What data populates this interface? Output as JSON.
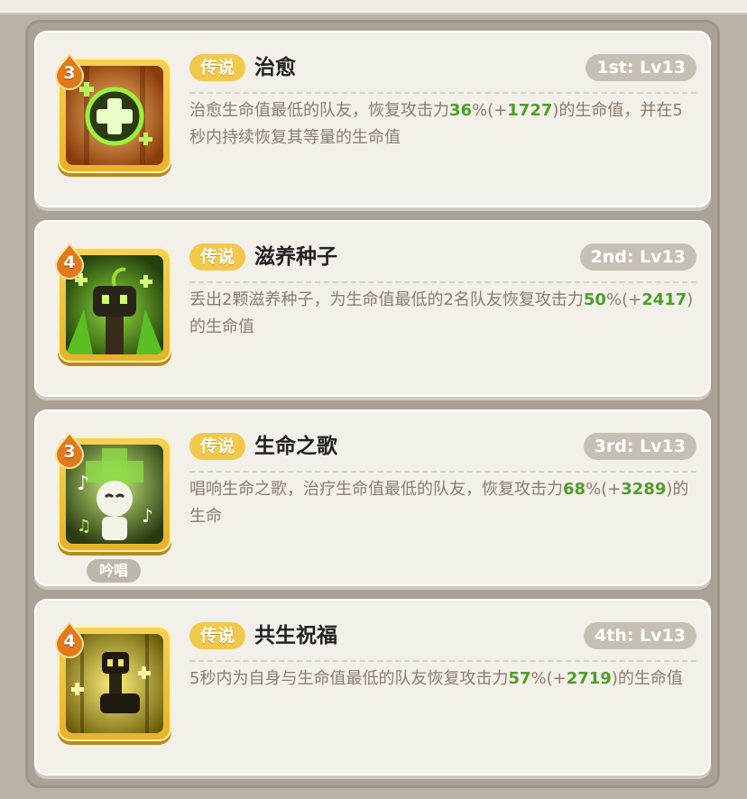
{
  "skills": [
    {
      "level": "3",
      "rarity": "传说",
      "name": "治愈",
      "rank": "1st: Lv13",
      "desc_before": "治愈生命值最低的队友，恢复攻击力",
      "percent": "36",
      "pct_sign": "%",
      "paren_open": "(+",
      "bonus": "1727",
      "paren_close": ")",
      "desc_after": "的生命值，并在5秒内持续恢复其等量的生命值",
      "icon": "heal-cross-icon"
    },
    {
      "level": "4",
      "rarity": "传说",
      "name": "滋养种子",
      "rank": "2nd: Lv13",
      "desc_before": "丢出2颗滋养种子，为生命值最低的2名队友恢复攻击力",
      "percent": "50",
      "pct_sign": "%",
      "paren_open": "(+",
      "bonus": "2417",
      "paren_close": ")",
      "desc_after": "的生命值",
      "icon": "seed-sprout-icon"
    },
    {
      "level": "3",
      "rarity": "传说",
      "name": "生命之歌",
      "rank": "3rd: Lv13",
      "desc_before": "唱响生命之歌，治疗生命值最低的队友，恢复攻击力",
      "percent": "68",
      "pct_sign": "%",
      "paren_open": "(+",
      "bonus": "3289",
      "paren_close": ")",
      "desc_after": "的生命",
      "icon": "song-of-life-icon",
      "tag": "吟唱"
    },
    {
      "level": "4",
      "rarity": "传说",
      "name": "共生祝福",
      "rank": "4th: Lv13",
      "desc_before": "5秒内为自身与生命值最低的队友恢复攻击力",
      "percent": "57",
      "pct_sign": "%",
      "paren_open": "(+",
      "bonus": "2719",
      "paren_close": ")",
      "desc_after": "的生命值",
      "icon": "symbiosis-blessing-icon"
    }
  ],
  "colors": {
    "accent_gold": "#f2c84b",
    "value_green": "#4d9e27",
    "rank_badge": "#c6bfb4",
    "card_bg": "#f3f0ea"
  }
}
